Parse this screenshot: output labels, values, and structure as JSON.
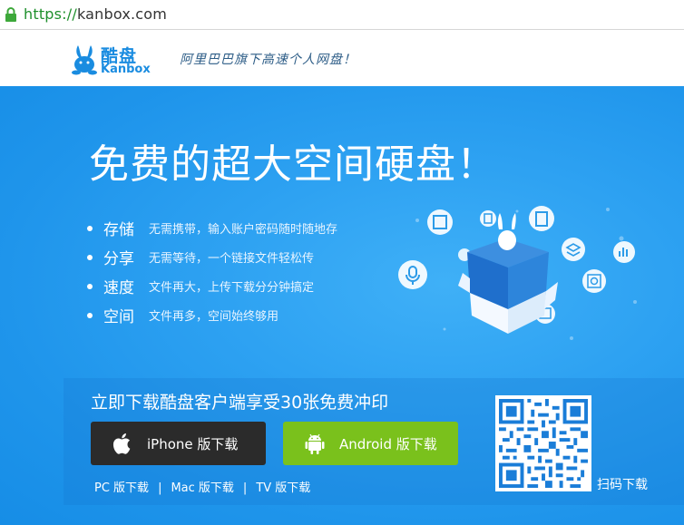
{
  "browser": {
    "url_scheme": "https://",
    "url_host": "kanbox.com"
  },
  "header": {
    "logo_cn": "酷盘",
    "logo_en": "Kanbox",
    "slogan": "阿里巴巴旗下高速个人网盘！"
  },
  "hero": {
    "title": "免费的超大空间硬盘！",
    "features": [
      {
        "name": "存储",
        "desc": "无需携带，输入账户密码随时随地存"
      },
      {
        "name": "分享",
        "desc": "无需等待，一个链接文件轻松传"
      },
      {
        "name": "速度",
        "desc": "文件再大，上传下载分分钟搞定"
      },
      {
        "name": "空间",
        "desc": "文件再多，空间始终够用"
      }
    ]
  },
  "download": {
    "title": "立即下载酷盘客户端享受30张免费冲印",
    "iphone_label": "iPhone 版下载",
    "android_label": "Android 版下载",
    "links": [
      "PC 版下载",
      "Mac 版下载",
      "TV 版下载"
    ],
    "separator": "|",
    "qr_label": "扫码下载"
  },
  "colors": {
    "accent_blue": "#1a8ce0",
    "hero_blue": "#1f95eb",
    "android_green": "#7ac11c",
    "iphone_dark": "#2b2b2b"
  },
  "icons": [
    "lock-icon",
    "rabbit-logo-icon",
    "apple-icon",
    "android-icon",
    "qr-code-icon"
  ]
}
